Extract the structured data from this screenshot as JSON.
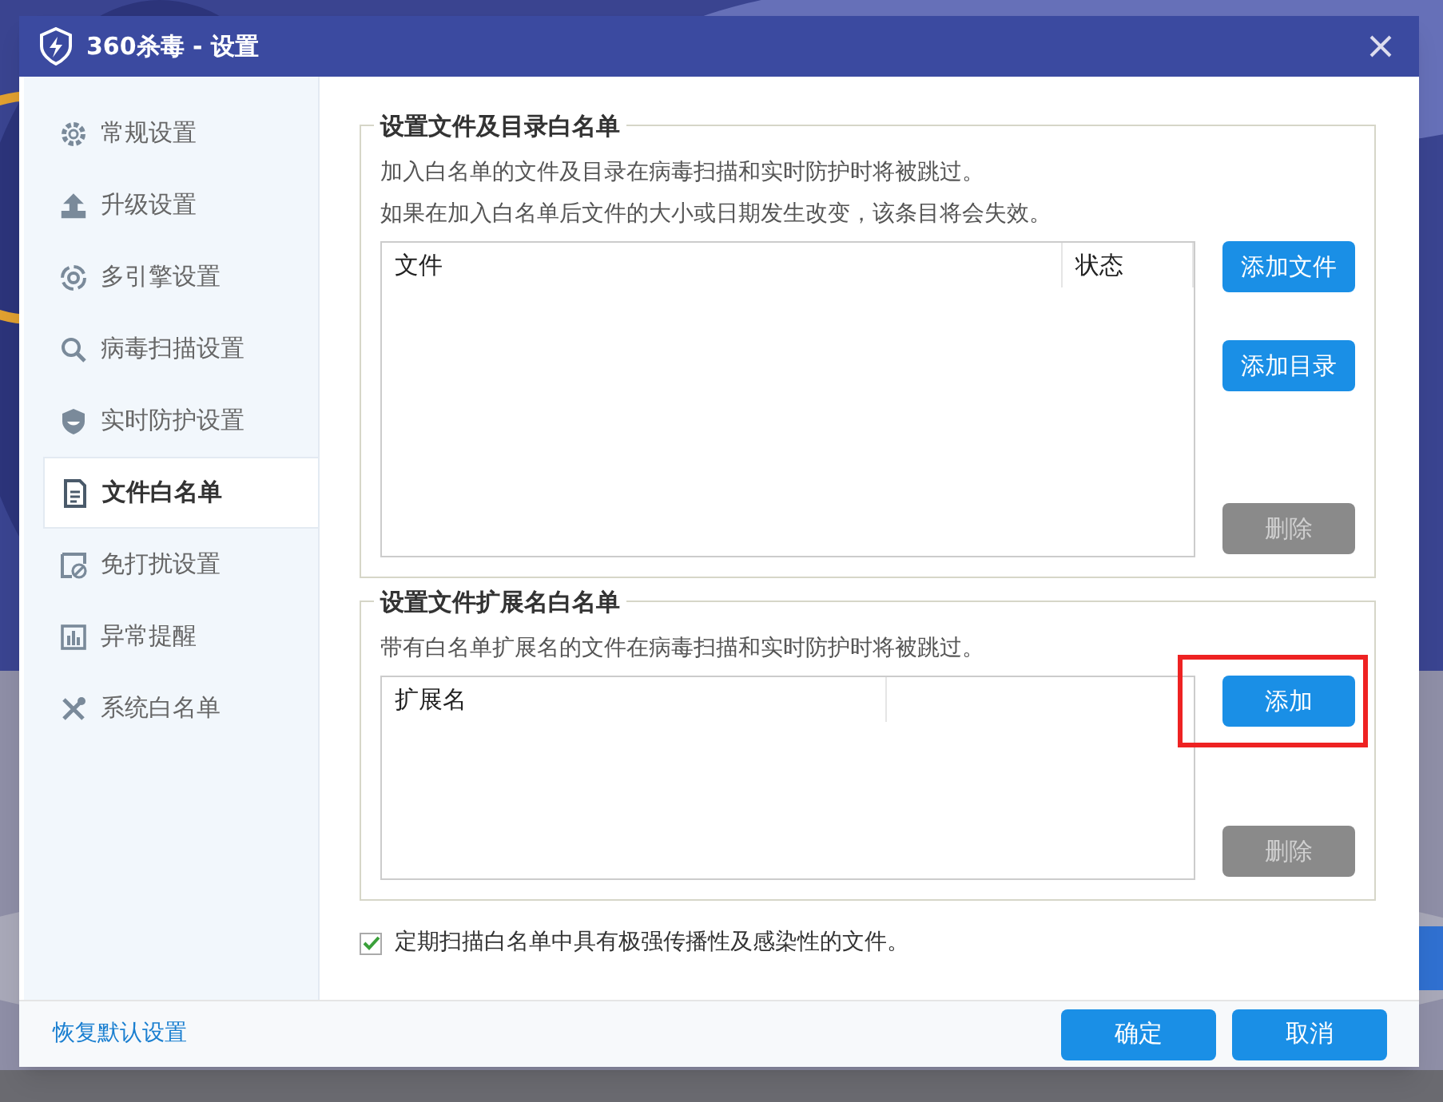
{
  "window": {
    "title": "360杀毒 - 设置"
  },
  "sidebar": {
    "items": [
      {
        "label": "常规设置",
        "selected": false
      },
      {
        "label": "升级设置",
        "selected": false
      },
      {
        "label": "多引擎设置",
        "selected": false
      },
      {
        "label": "病毒扫描设置",
        "selected": false
      },
      {
        "label": "实时防护设置",
        "selected": false
      },
      {
        "label": "文件白名单",
        "selected": true
      },
      {
        "label": "免打扰设置",
        "selected": false
      },
      {
        "label": "异常提醒",
        "selected": false
      },
      {
        "label": "系统白名单",
        "selected": false
      }
    ]
  },
  "file_whitelist": {
    "title": "设置文件及目录白名单",
    "description": [
      "加入白名单的文件及目录在病毒扫描和实时防护时将被跳过。",
      "如果在加入白名单后文件的大小或日期发生改变，该条目将会失效。"
    ],
    "columns": [
      "文件",
      "状态"
    ],
    "buttons": [
      {
        "label": "添加文件",
        "disabled": false
      },
      {
        "label": "添加目录",
        "disabled": false
      },
      {
        "label": "删除",
        "disabled": true
      }
    ]
  },
  "extension_whitelist": {
    "title": "设置文件扩展名白名单",
    "description": [
      "带有白名单扩展名的文件在病毒扫描和实时防护时将被跳过。"
    ],
    "columns": [
      "扩展名"
    ],
    "buttons": [
      {
        "label": "添加",
        "disabled": false,
        "highlighted": true
      },
      {
        "label": "删除",
        "disabled": true
      }
    ]
  },
  "periodic_scan": {
    "label": "定期扫描白名单中具有极强传播性及感染性的文件。",
    "checked": true
  },
  "footer": {
    "restore_link": "恢复默认设置",
    "buttons": [
      "确定",
      "取消"
    ]
  }
}
